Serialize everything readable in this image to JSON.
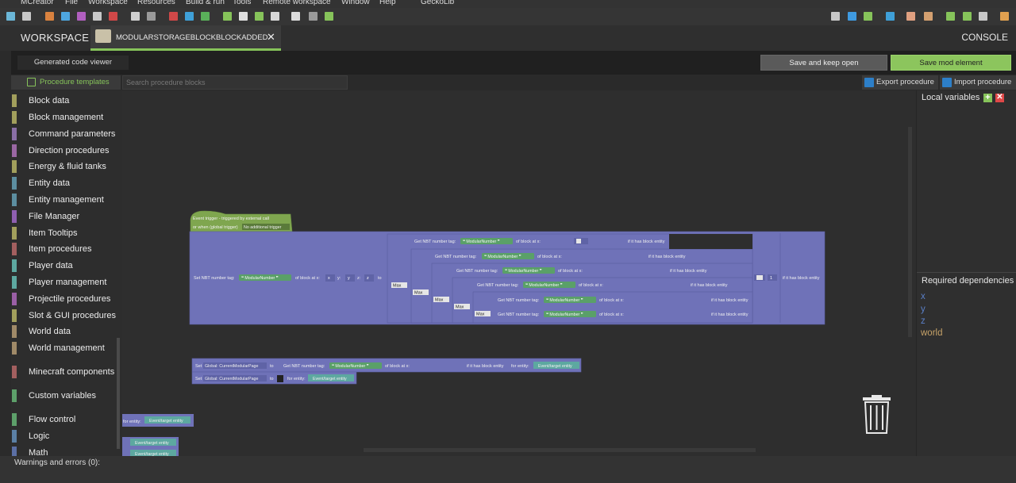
{
  "menu": [
    "MCreator",
    "File",
    "Workspace",
    "Resources",
    "Build & run",
    "Tools",
    "Remote workspace",
    "Window",
    "Help",
    "GeckoLib"
  ],
  "tabs": {
    "workspace": "WORKSPACE",
    "element": "MODULARSTORAGEBLOCKBLOCKADDED",
    "console": "CONSOLE"
  },
  "codebar": {
    "generated": "Generated code viewer",
    "save_open": "Save and keep open",
    "save_mod": "Save mod element"
  },
  "procbar": {
    "templates": "Procedure templates",
    "search_placeholder": "Search procedure blocks",
    "export": "Export procedure",
    "import": "Import procedure"
  },
  "palette": [
    {
      "label": "Block data",
      "color": "#a29f5c"
    },
    {
      "label": "Block management",
      "color": "#a29f5c"
    },
    {
      "label": "Command parameters",
      "color": "#8a6fa6"
    },
    {
      "label": "Direction procedures",
      "color": "#9a67a3"
    },
    {
      "label": "Energy & fluid tanks",
      "color": "#a29f5c"
    },
    {
      "label": "Entity data",
      "color": "#5c8ea0"
    },
    {
      "label": "Entity management",
      "color": "#5c8ea0"
    },
    {
      "label": "File Manager",
      "color": "#8f5fb0"
    },
    {
      "label": "Item Tooltips",
      "color": "#a29f5c"
    },
    {
      "label": "Item procedures",
      "color": "#a35f5f"
    },
    {
      "label": "Player data",
      "color": "#5da8a0"
    },
    {
      "label": "Player management",
      "color": "#5da8a0"
    },
    {
      "label": "Projectile procedures",
      "color": "#9a5fa5"
    },
    {
      "label": "Slot & GUI procedures",
      "color": "#a29f5c"
    },
    {
      "label": "World data",
      "color": "#a08a68"
    },
    {
      "label": "World management",
      "color": "#a08a68"
    },
    {
      "label": "Minecraft components",
      "color": "#a35f5f"
    },
    {
      "label": "Custom variables",
      "color": "#5da06a"
    },
    {
      "label": "Flow control",
      "color": "#5da06a"
    },
    {
      "label": "Logic",
      "color": "#5b80a5"
    },
    {
      "label": "Math",
      "color": "#5b6fa5"
    }
  ],
  "blocks": {
    "trigger_line1": "Event trigger - triggered by external call",
    "trigger_line2": "or when (global trigger)",
    "trigger_pill": "No additional trigger",
    "set_nbt": "Set NBT number tag:",
    "get_nbt": "Get NBT number tag:",
    "tag_name": "ModularNumber",
    "of_block_at_x": "of block at x:",
    "y": "y:",
    "z": "z:",
    "x_val": "x",
    "y_val": "y",
    "z_val": "z",
    "one": "1",
    "to": "to",
    "max": "Max",
    "if_has_entity": "if it has block entity",
    "set": "Set",
    "global_var": "Global: CurrentModularPage",
    "for_entity": "for entity:",
    "event_target": "Event/target entity"
  },
  "right_panel": {
    "local_vars": "Local variables",
    "required": "Required dependencies",
    "dependencies": [
      {
        "name": "x",
        "color": "#5b80c8"
      },
      {
        "name": "y",
        "color": "#5b80c8"
      },
      {
        "name": "z",
        "color": "#5b80c8"
      },
      {
        "name": "world",
        "color": "#c6a268"
      }
    ]
  },
  "warnings": "Warnings and errors (0):",
  "colors": {
    "accent": "#86c35a",
    "block_purple": "#6f72b8",
    "block_dark": "#5f63a6",
    "string_green": "#5aa068",
    "trigger_green": "#7fa64f"
  }
}
